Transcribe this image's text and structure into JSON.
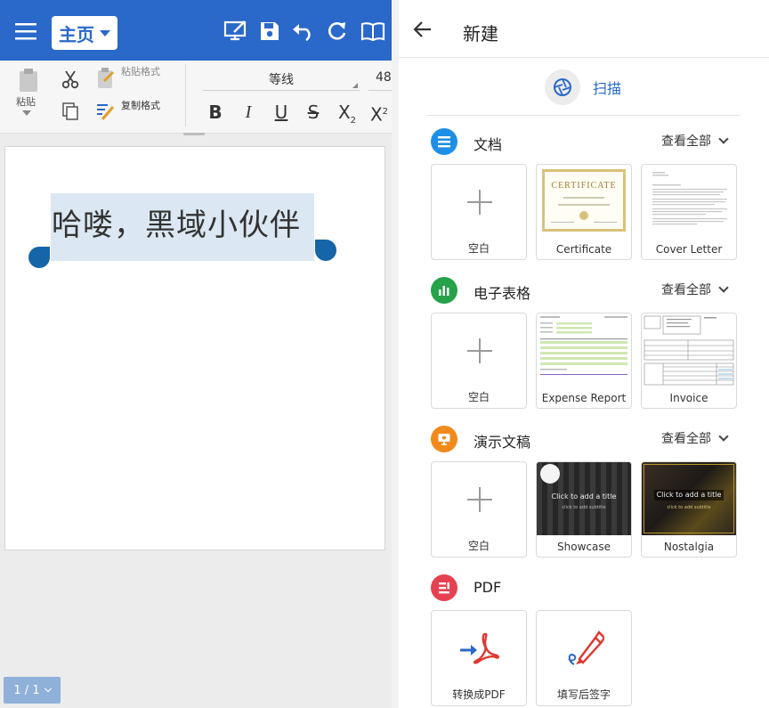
{
  "left": {
    "home_label": "主页",
    "ribbon": {
      "paste_label": "粘贴",
      "paste_format_label": "粘贴格式",
      "copy_format_label": "复制格式",
      "font_name": "等线",
      "font_size": "48",
      "bold": "B",
      "italic": "I",
      "underline": "U",
      "strike": "S",
      "subscript": "X",
      "subscript_mark": "2",
      "superscript": "X",
      "superscript_mark": "2"
    },
    "doc_text": "哈喽，黑域小伙伴",
    "page_indicator": "1 / 1"
  },
  "right": {
    "title": "新建",
    "scan_label": "扫描",
    "sections": [
      {
        "title": "文档",
        "see_all": "查看全部",
        "color": "#1e8fe6",
        "cards": [
          "空白",
          "Certificate",
          "Cover Letter"
        ]
      },
      {
        "title": "电子表格",
        "see_all": "查看全部",
        "color": "#25a24a",
        "cards": [
          "空白",
          "Expense Report",
          "Invoice"
        ]
      },
      {
        "title": "演示文稿",
        "see_all": "查看全部",
        "color": "#f08a1c",
        "cards": [
          "空白",
          "Showcase",
          "Nostalgia"
        ]
      },
      {
        "title": "PDF",
        "see_all": "",
        "color": "#e64150",
        "cards": [
          "转换成PDF",
          "填写后签字"
        ]
      }
    ],
    "thumbs": {
      "certificate_title": "CERTIFICATE",
      "slide_title": "Click to add a title",
      "slide_subtitle": "click to add subtitle"
    }
  },
  "colors": {
    "topbar": "#2a68c9",
    "accent": "#2a68c9",
    "handle": "#1565a8"
  }
}
